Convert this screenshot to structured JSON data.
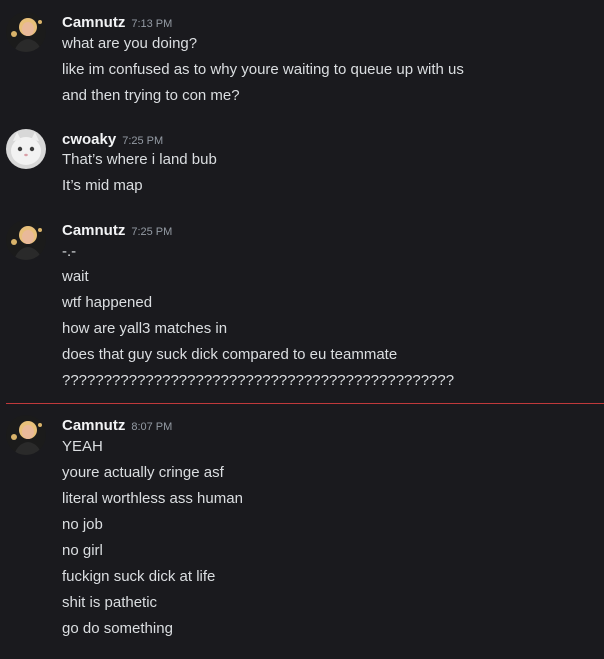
{
  "messages": [
    {
      "user": "Camnutz",
      "time": "7:13 PM",
      "avatar_icon": "blonde-person-avatar",
      "lines": [
        "what are you doing?",
        "like im confused as to why youre waiting to queue up with us",
        "and then trying to con me?"
      ]
    },
    {
      "user": "cwoaky",
      "time": "7:25 PM",
      "avatar_icon": "white-cat-avatar",
      "lines": [
        "That’s where i land bub",
        "It’s mid map"
      ]
    },
    {
      "user": "Camnutz",
      "time": "7:25 PM",
      "avatar_icon": "blonde-person-avatar",
      "lines": [
        "-.-",
        "wait",
        "wtf happened",
        "how are yall3 matches in",
        "does that guy suck dick compared to eu teammate",
        "???????????????????????????????????????????????"
      ]
    },
    {
      "user": "Camnutz",
      "time": "8:07 PM",
      "avatar_icon": "blonde-person-avatar",
      "lines": [
        "YEAH",
        "youre actually cringe asf",
        "literal worthless ass human",
        "no job",
        "no girl",
        "fuckign suck dick at life",
        "shit is pathetic",
        "go do something"
      ]
    }
  ],
  "colors": {
    "background": "#1a1a1e",
    "username": "#f2f3f5",
    "text": "#dbdee1",
    "timestamp": "#949ba4",
    "new_divider": "#c0393b"
  }
}
